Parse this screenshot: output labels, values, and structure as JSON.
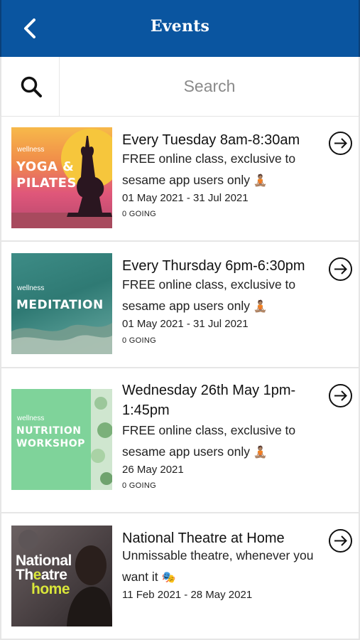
{
  "header": {
    "title": "Events",
    "back_icon": "chevron-left-icon",
    "background_color": "#0a55a0"
  },
  "search": {
    "icon": "search-icon",
    "placeholder": "Search"
  },
  "events": [
    {
      "image_tag": "wellness",
      "image_text_line1": "YOGA &",
      "image_text_line2": "PILATES",
      "title": "Every Tuesday 8am-8:30am",
      "description": "FREE online class, exclusive to sesame app users only",
      "emoji": "🧘🏽",
      "dates": "01 May 2021 - 31 Jul 2021",
      "going": "0 GOING"
    },
    {
      "image_tag": "wellness",
      "image_text_line1": "MEDITATION",
      "title": "Every Thursday 6pm-6:30pm",
      "description": "FREE online class, exclusive to sesame app users only",
      "emoji": "🧘🏽",
      "dates": "01 May 2021 - 31 Jul 2021",
      "going": "0 GOING"
    },
    {
      "image_tag": "wellness",
      "image_text_line1": "NUTRITION",
      "image_text_line2": "WORKSHOP",
      "title_line1": "Wednesday 26th May 1pm-",
      "title_line2": "1:45pm",
      "description": "FREE online class, exclusive to sesame app users only",
      "emoji": "🧘🏽",
      "dates": "26 May 2021",
      "going": "0 GOING"
    },
    {
      "image_text_line1": "National",
      "image_text_line2_a": "Th",
      "image_text_line2_b": "e",
      "image_text_line2_c": "atre",
      "image_text_line3": "home",
      "title": "National Theatre at Home",
      "description": "Unmissable theatre, whenever you want it",
      "emoji": "🎭",
      "dates": "11 Feb 2021 - 28 May 2021"
    }
  ],
  "arrow_icon": "arrow-right-circle-icon"
}
